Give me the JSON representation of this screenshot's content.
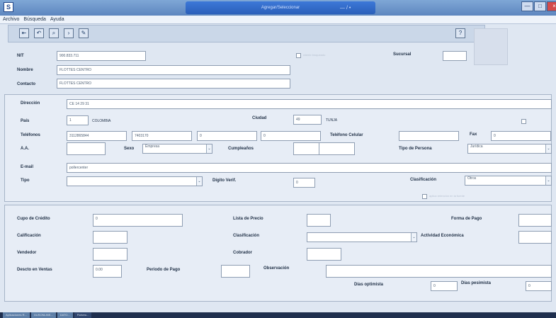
{
  "window": {
    "title": "Agregar/Seleccionar",
    "icon": "app-icon",
    "title_left_glyphs": "• • /",
    "title_right_glyphs": "— / •"
  },
  "menu": {
    "items": [
      "Archivo",
      "Búsqueda",
      "Ayuda"
    ]
  },
  "toolbar": {
    "buttons": [
      "first-icon",
      "prev-icon",
      "search-icon",
      "next-icon",
      "edit-icon"
    ],
    "right_button": "help-icon"
  },
  "client": {
    "nit_label": "NIT",
    "nit_value": "900.833.711",
    "nombre_label": "Nombre",
    "nombre_value": "FLOTTES CENTRO",
    "contacto_label": "Contacto",
    "contacto_value": "FLOTTES CENTRO",
    "sucursal_label": "Sucursal",
    "checkbox_label": "cliente bloqueado"
  },
  "address": {
    "direccion_label": "Dirección",
    "direccion_value": "CE 14 29 31",
    "pais_label": "País",
    "pais_code": "1",
    "pais_name": "COLOMBIA",
    "ciudad_label": "Ciudad",
    "ciudad_code": "49",
    "ciudad_name": "TUNJA",
    "telefonos_label": "Teléfonos",
    "tel1": "3112865844",
    "tel2": "7403170",
    "tel3": "0",
    "tel4": "0",
    "celular_label": "Teléfono Celular",
    "fax_label": "Fax",
    "fax_value": "0",
    "aa_label": "A.A.",
    "sexo_label": "Sexo",
    "sexo_value": "Empresa",
    "cumpleanos_label": "Cumpleaños",
    "tipo_persona_label": "Tipo de Persona",
    "tipo_persona_value": "Jurídica",
    "email_label": "E-mail",
    "email_value": "pollercenter",
    "tipo_label": "Tipo",
    "digito_label": "Dígito Verif.",
    "digito_value": "0",
    "clasificacion_label": "Clasificación",
    "clasificacion_value": "Otros",
    "side_check_label": "",
    "bottom_check_label": "aplica retención en la fuente"
  },
  "credit": {
    "cupo_label": "Cupo de Crédito",
    "cupo_value": "0",
    "lista_label": "Lista de Precio",
    "forma_pago_label": "Forma de Pago",
    "calificacion_label": "Calificación",
    "clasificacion_label": "Clasificación",
    "actividad_label": "Actividad Económica",
    "vendedor_label": "Vendedor",
    "cobrador_label": "Cobrador",
    "descto_label": "Descto en Ventas",
    "descto_value": "0.00",
    "periodo_label": "Periodo de Pago",
    "observacion_label": "Observación",
    "dias_optimista_label": "Días optimista",
    "dias_optimista_value": "0",
    "dias_pesimista_label": "Días pesimista",
    "dias_pesimista_value": "0"
  },
  "taskbar": {
    "tabs": [
      "Aplicaciones R...",
      "GUSONLINE...",
      "DATO...",
      "Fichero..."
    ]
  }
}
